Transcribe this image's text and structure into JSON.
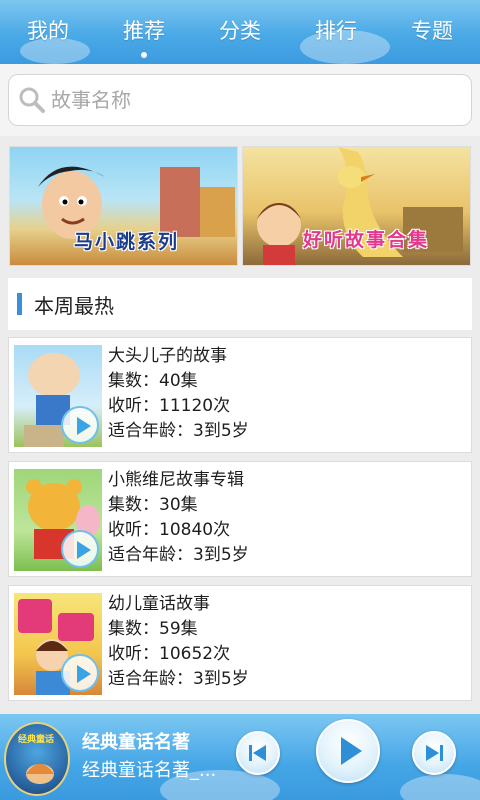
{
  "tabs": [
    {
      "label": "我的"
    },
    {
      "label": "推荐"
    },
    {
      "label": "分类"
    },
    {
      "label": "排行"
    },
    {
      "label": "专题"
    }
  ],
  "active_tab": "推荐",
  "search": {
    "placeholder": "故事名称"
  },
  "banners": [
    {
      "title": "马小跳系列"
    },
    {
      "title": "好听故事合集"
    }
  ],
  "section": {
    "title": "本周最热"
  },
  "stories": [
    {
      "title": "大头儿子的故事",
      "episodes": "集数：40集",
      "plays": "收听：11120次",
      "age": "适合年龄：3到5岁"
    },
    {
      "title": "小熊维尼故事专辑",
      "episodes": "集数：30集",
      "plays": "收听：10840次",
      "age": "适合年龄：3到5岁"
    },
    {
      "title": "幼儿童话故事",
      "episodes": "集数：59集",
      "plays": "收听：10652次",
      "age": "适合年龄：3到5岁"
    }
  ],
  "player": {
    "cover_text": "经典童话",
    "title": "经典童话名著",
    "subtitle": "经典童话名著_..."
  },
  "colors": {
    "primary": "#4aa9e6",
    "section_bar": "#3b8fd8",
    "banner1_text": "#1b3c8a",
    "banner2_text": "#e4388a"
  }
}
